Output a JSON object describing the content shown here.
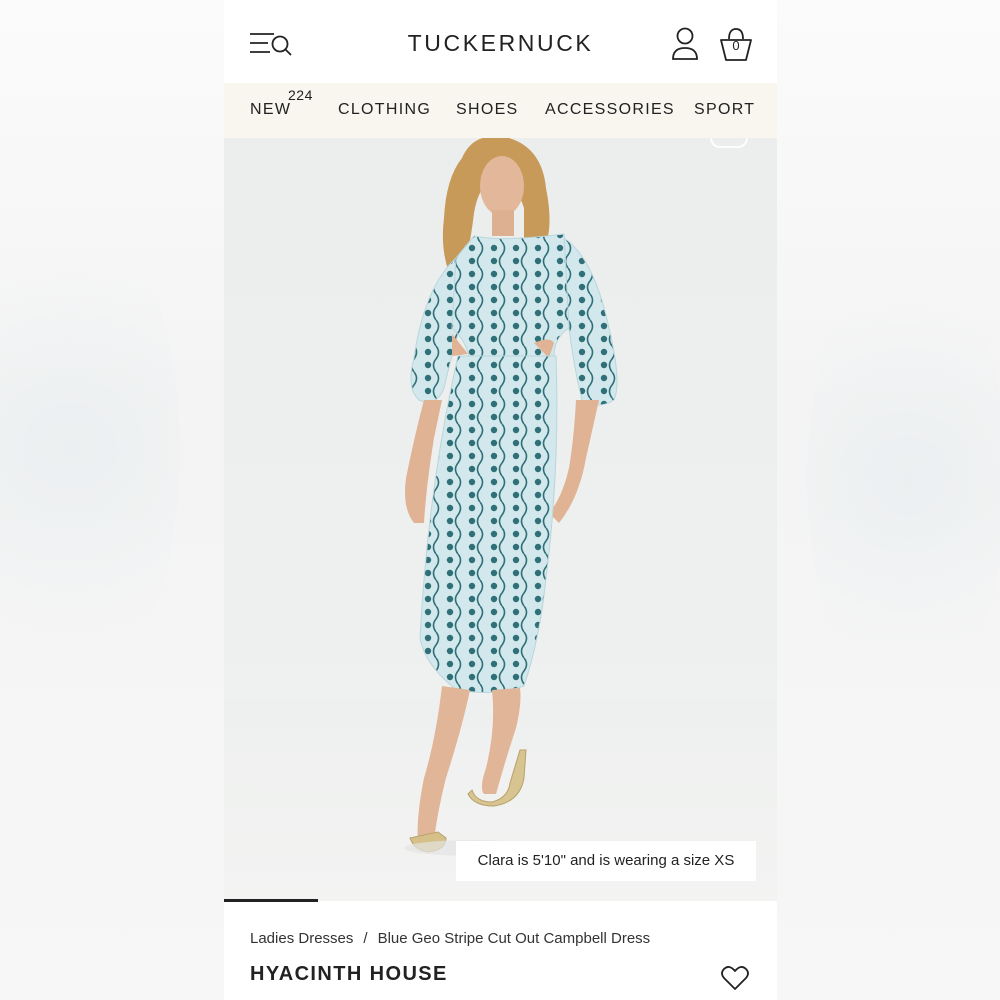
{
  "header": {
    "brand": "TUCKERNUCK",
    "bag_count": "0"
  },
  "nav": {
    "items": [
      {
        "label": "NEW"
      },
      {
        "label": "CLOTHING"
      },
      {
        "label": "SHOES"
      },
      {
        "label": "ACCESSORIES"
      },
      {
        "label": "SPORT"
      }
    ],
    "new_badge": "224"
  },
  "product": {
    "size_note": "Clara is 5'10\" and is wearing a size XS",
    "breadcrumb": {
      "category": "Ladies Dresses",
      "separator": "/",
      "current": "Blue Geo Stripe Cut Out Campbell Dress"
    },
    "designer": "HYACINTH HOUSE",
    "image_count_progress": 0.17
  },
  "icons": {
    "menu": "menu-search-icon",
    "account": "account-icon",
    "bag": "shopping-bag-icon",
    "favorite": "heart-icon"
  },
  "colors": {
    "nav_bg": "#f8f6ef",
    "dress_base": "#cfe6ea",
    "dress_pattern": "#2f6f78",
    "text": "#222222"
  }
}
